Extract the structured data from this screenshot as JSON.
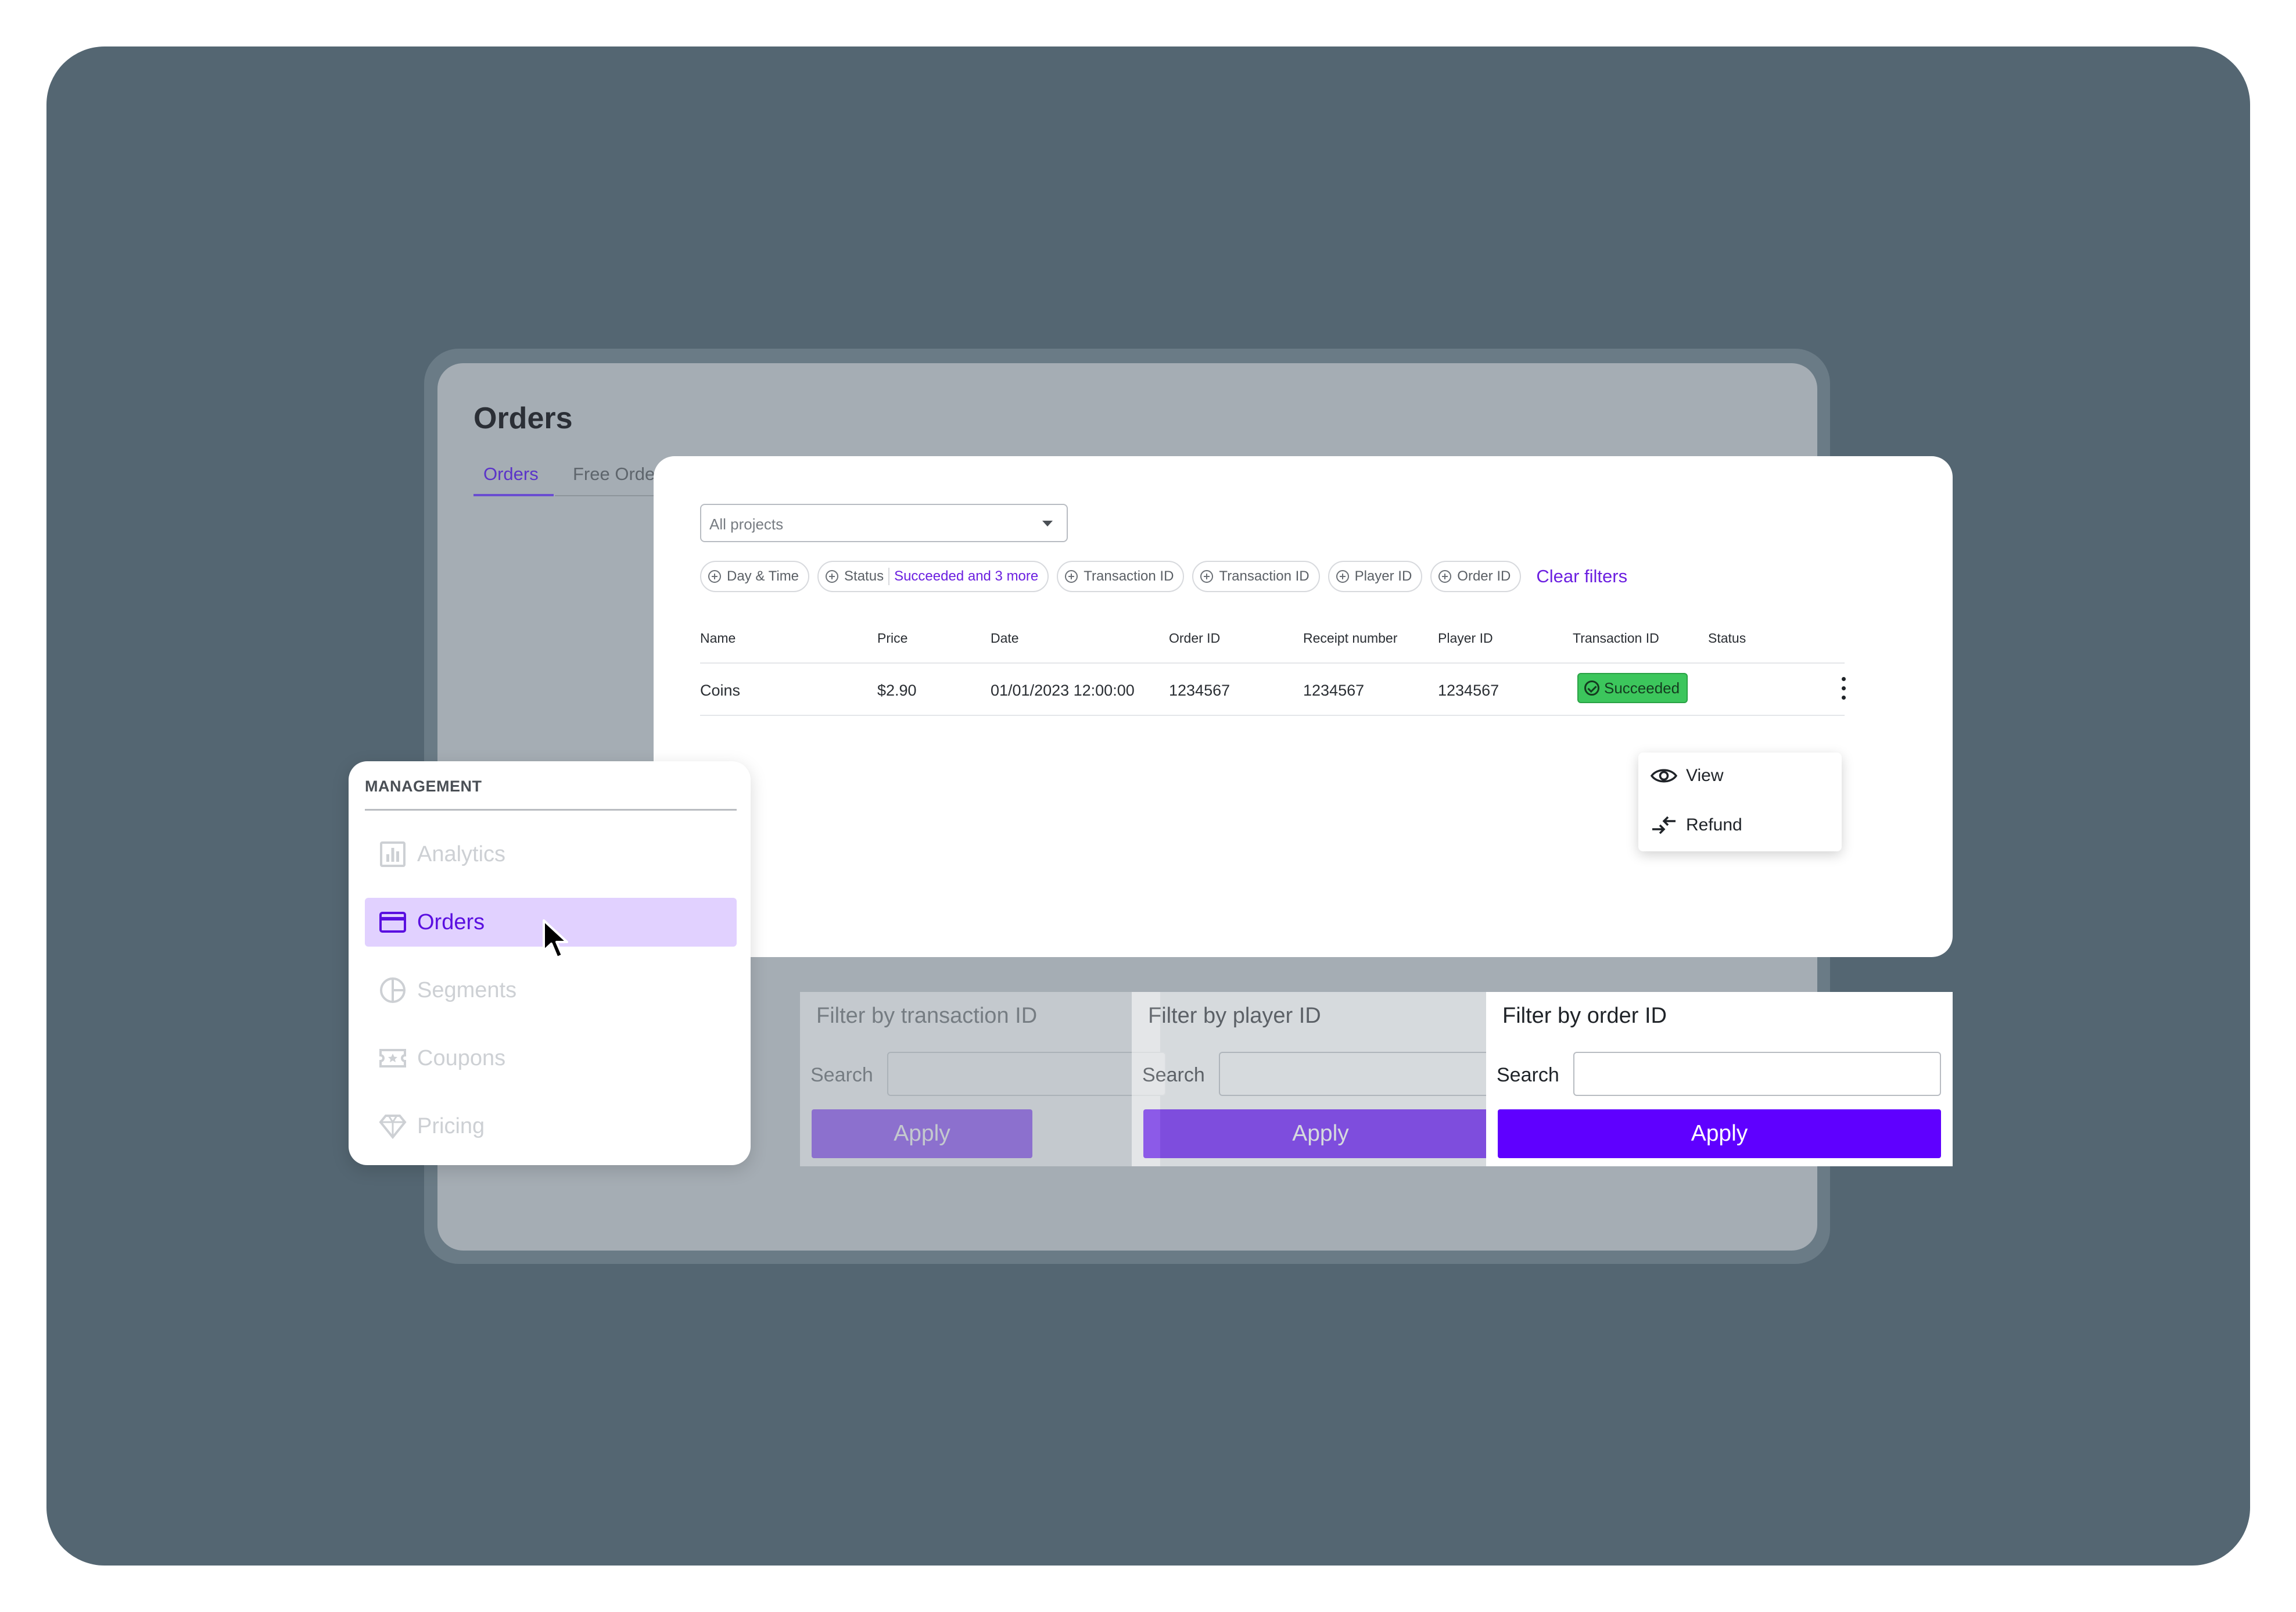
{
  "page": {
    "title": "Orders",
    "tabs": [
      {
        "label": "Orders",
        "active": true
      },
      {
        "label": "Free Orders",
        "active": false
      }
    ]
  },
  "filters": {
    "project_select": "All projects",
    "chips": [
      {
        "label": "Day & Time",
        "value": ""
      },
      {
        "label": "Status",
        "value": "Succeeded and 3 more"
      },
      {
        "label": "Transaction ID",
        "value": ""
      },
      {
        "label": "Transaction ID",
        "value": ""
      },
      {
        "label": "Player ID",
        "value": ""
      },
      {
        "label": "Order ID",
        "value": ""
      }
    ],
    "clear_label": "Clear filters"
  },
  "table": {
    "columns": [
      "Name",
      "Price",
      "Date",
      "Order ID",
      "Receipt number",
      "Player ID",
      "Transaction ID",
      "Status"
    ],
    "rows": [
      {
        "name": "Coins",
        "price": "$2.90",
        "date": "01/01/2023 12:00:00",
        "order_id": "1234567",
        "receipt": "1234567",
        "player_id": "1234567",
        "status": "Succeeded"
      }
    ]
  },
  "row_menu": {
    "items": [
      {
        "label": "View",
        "icon": "eye-icon"
      },
      {
        "label": "Refund",
        "icon": "refund-arrows-icon"
      }
    ]
  },
  "sidebar": {
    "section_title": "MANAGEMENT",
    "items": [
      {
        "label": "Analytics",
        "icon": "bar-chart-icon",
        "active": false
      },
      {
        "label": "Orders",
        "icon": "credit-card-icon",
        "active": true
      },
      {
        "label": "Segments",
        "icon": "pie-chart-icon",
        "active": false
      },
      {
        "label": "Coupons",
        "icon": "coupon-icon",
        "active": false
      },
      {
        "label": "Pricing",
        "icon": "diamond-icon",
        "active": false
      }
    ]
  },
  "filter_panels": [
    {
      "title": "Filter by transaction ID",
      "search_label": "Search",
      "apply_label": "Apply"
    },
    {
      "title": "Filter by player ID",
      "search_label": "Search",
      "apply_label": "Apply"
    },
    {
      "title": "Filter by order ID",
      "search_label": "Search",
      "apply_label": "Apply"
    }
  ],
  "colors": {
    "accent": "#5f00ff",
    "accent_light": "#e1d1ff",
    "success": "#3cc65c",
    "backdrop": "#546672"
  }
}
